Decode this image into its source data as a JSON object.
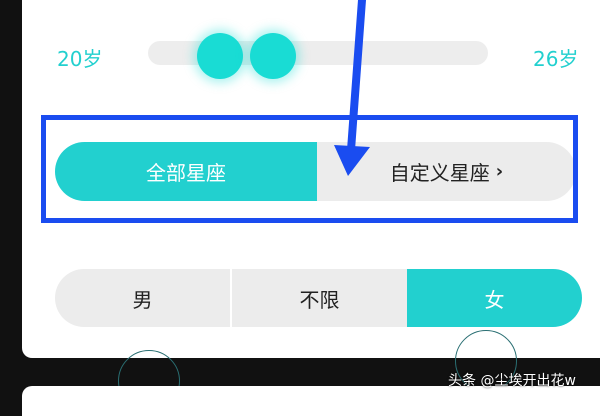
{
  "age_filter": {
    "min_label": "20岁",
    "max_label": "26岁"
  },
  "zodiac_filter": {
    "all_label": "全部星座",
    "custom_label": "自定义星座",
    "custom_chevron": "›",
    "selected": "all"
  },
  "gender_filter": {
    "options": [
      "男",
      "不限",
      "女"
    ],
    "selected": "女"
  },
  "colors": {
    "accent": "#22d0cf",
    "highlight_box": "#1a4cf0",
    "segment_inactive": "#ececec"
  },
  "watermark": "头条 @尘埃开出花w"
}
